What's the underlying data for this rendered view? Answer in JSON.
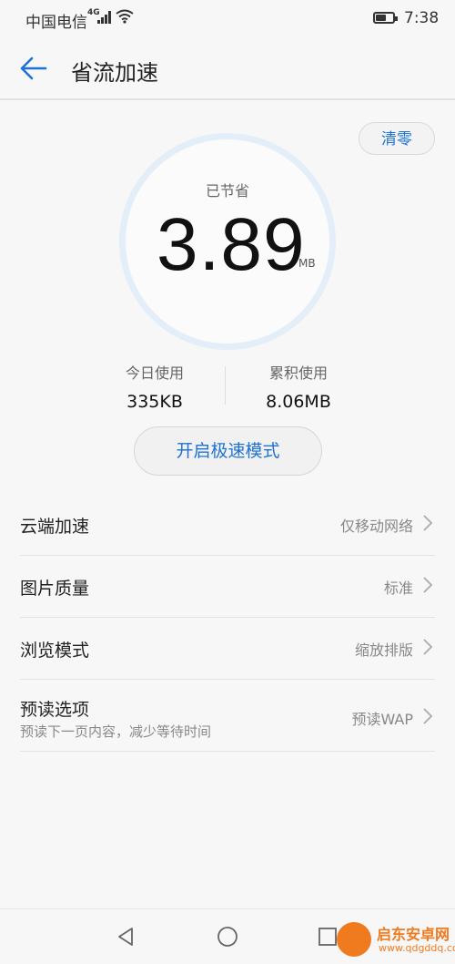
{
  "status_bar": {
    "carrier": "中国电信",
    "network": "4G",
    "time": "7:38"
  },
  "header": {
    "title": "省流加速",
    "back_icon": "back-arrow-icon"
  },
  "summary": {
    "clear_label": "清零",
    "saved_label": "已节省",
    "saved_value": "3.89",
    "saved_unit": "MB",
    "today_label": "今日使用",
    "today_value": "335KB",
    "total_label": "累积使用",
    "total_value": "8.06MB",
    "speed_mode_label": "开启极速模式"
  },
  "settings": [
    {
      "name": "云端加速",
      "value": "仅移动网络"
    },
    {
      "name": "图片质量",
      "value": "标准"
    },
    {
      "name": "浏览模式",
      "value": "缩放排版"
    },
    {
      "name": "预读选项",
      "value": "预读WAP",
      "sub": "预读下一页内容，减少等待时间"
    }
  ],
  "watermark": {
    "text": "启东安卓网",
    "url": "www.qdgddq.com"
  },
  "colors": {
    "accent": "#1e73d2",
    "ring": "#e3eef9",
    "watermark": "#f07a1e"
  }
}
